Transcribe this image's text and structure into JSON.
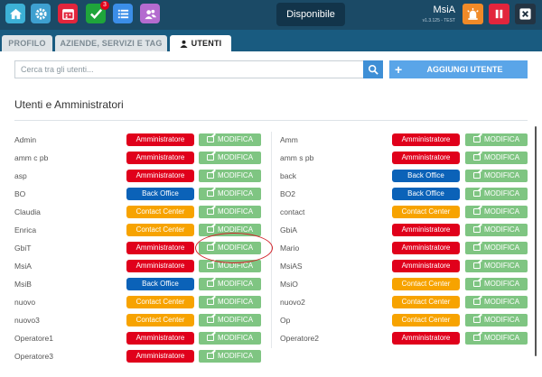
{
  "topbar": {
    "notification_count": "3",
    "status": "Disponibile",
    "user_name": "MsiA",
    "version": "v1.3.125 - TEST",
    "colors": {
      "home": "#3cb1d6",
      "settings": "#3ea0d0",
      "calendar": "#e2253c",
      "tasks": "#1fa53b",
      "list": "#3b8ee8",
      "contacts": "#b46bcf",
      "alarm": "#f08a28",
      "pause": "#e2253c",
      "close": "#233443"
    }
  },
  "tabs": [
    "PROFILO",
    "AZIENDE, SERVIZI E TAG",
    "UTENTI"
  ],
  "search": {
    "placeholder": "Cerca tra gli utenti..."
  },
  "add_user_label": "AGGIUNGI UTENTE",
  "section_title": "Utenti e Amministratori",
  "edit_label": "MODIFICA",
  "role_labels": {
    "admin": "Amministratore",
    "bo": "Back Office",
    "cc": "Contact Center"
  },
  "left_users": [
    {
      "name": "Admin",
      "role": "admin"
    },
    {
      "name": "amm c pb",
      "role": "admin"
    },
    {
      "name": "asp",
      "role": "admin"
    },
    {
      "name": "BO",
      "role": "bo"
    },
    {
      "name": "Claudia",
      "role": "cc"
    },
    {
      "name": "Enrica",
      "role": "cc"
    },
    {
      "name": "GbiT",
      "role": "admin"
    },
    {
      "name": "MsiA",
      "role": "admin"
    },
    {
      "name": "MsiB",
      "role": "bo"
    },
    {
      "name": "nuovo",
      "role": "cc"
    },
    {
      "name": "nuovo3",
      "role": "cc"
    },
    {
      "name": "Operatore1",
      "role": "admin"
    },
    {
      "name": "Operatore3",
      "role": "admin"
    }
  ],
  "right_users": [
    {
      "name": "Amm",
      "role": "admin"
    },
    {
      "name": "amm s pb",
      "role": "admin"
    },
    {
      "name": "back",
      "role": "bo"
    },
    {
      "name": "BO2",
      "role": "bo"
    },
    {
      "name": "contact",
      "role": "cc"
    },
    {
      "name": "GbiA",
      "role": "admin"
    },
    {
      "name": "Mario",
      "role": "admin"
    },
    {
      "name": "MsiAS",
      "role": "admin"
    },
    {
      "name": "MsiO",
      "role": "cc"
    },
    {
      "name": "nuovo2",
      "role": "cc"
    },
    {
      "name": "Op",
      "role": "cc"
    },
    {
      "name": "Operatore2",
      "role": "admin"
    }
  ]
}
